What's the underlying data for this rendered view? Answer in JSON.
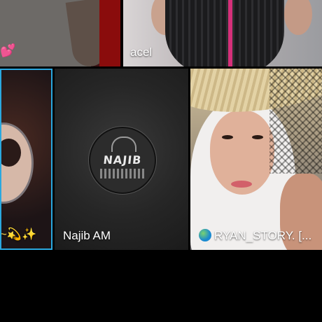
{
  "tiles": [
    {
      "id": "top-left",
      "name": "",
      "decoration": "💕",
      "highlighted": false
    },
    {
      "id": "top-right",
      "name": "acel",
      "highlighted": false
    },
    {
      "id": "bottom-left",
      "name": "~💫✨",
      "highlighted": true,
      "highlight_color": "#2aa8df"
    },
    {
      "id": "bottom-middle",
      "name": "Najib AM",
      "logo_text": "NAJIB",
      "highlighted": false
    },
    {
      "id": "bottom-right",
      "name": "RYAN_STORY. [...",
      "icon": "globe-icon",
      "highlighted": false
    }
  ],
  "colors": {
    "background": "#000000",
    "active_border": "#2aa8df"
  }
}
